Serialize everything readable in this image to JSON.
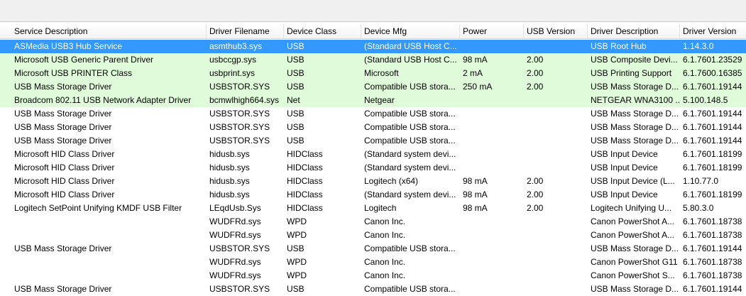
{
  "colors": {
    "selected": "#3399ff",
    "connected": "#e0fbd9"
  },
  "columns": [
    "Service Description",
    "Driver Filename",
    "Device Class",
    "Device Mfg",
    "Power",
    "USB Version",
    "Driver Description",
    "Driver Version"
  ],
  "rows": [
    {
      "state": "selected",
      "cells": [
        "ASMedia USB3 Hub Service",
        "asmthub3.sys",
        "USB",
        "(Standard USB Host C...",
        "",
        "",
        "USB Root Hub",
        "1.14.3.0"
      ]
    },
    {
      "state": "green",
      "cells": [
        "Microsoft USB Generic Parent Driver",
        "usbccgp.sys",
        "USB",
        "(Standard USB Host C...",
        "98 mA",
        "2.00",
        "USB Composite Devi...",
        "6.1.7601.23529"
      ]
    },
    {
      "state": "green",
      "cells": [
        "Microsoft USB PRINTER Class",
        "usbprint.sys",
        "USB",
        "Microsoft",
        "2 mA",
        "2.00",
        "USB Printing Support",
        "6.1.7600.16385"
      ]
    },
    {
      "state": "green",
      "cells": [
        "USB Mass Storage Driver",
        "USBSTOR.SYS",
        "USB",
        "Compatible USB stora...",
        "250 mA",
        "2.00",
        "USB Mass Storage D...",
        "6.1.7601.19144"
      ]
    },
    {
      "state": "green",
      "cells": [
        "Broadcom 802.11 USB Network Adapter Driver",
        "bcmwlhigh664.sys",
        "Net",
        "Netgear",
        "",
        "",
        "NETGEAR WNA3100 ...",
        "5.100.148.5"
      ]
    },
    {
      "state": "",
      "cells": [
        "USB Mass Storage Driver",
        "USBSTOR.SYS",
        "USB",
        "Compatible USB stora...",
        "",
        "",
        "USB Mass Storage D...",
        "6.1.7601.19144"
      ]
    },
    {
      "state": "",
      "cells": [
        "USB Mass Storage Driver",
        "USBSTOR.SYS",
        "USB",
        "Compatible USB stora...",
        "",
        "",
        "USB Mass Storage D...",
        "6.1.7601.19144"
      ]
    },
    {
      "state": "",
      "cells": [
        "USB Mass Storage Driver",
        "USBSTOR.SYS",
        "USB",
        "Compatible USB stora...",
        "",
        "",
        "USB Mass Storage D...",
        "6.1.7601.19144"
      ]
    },
    {
      "state": "",
      "cells": [
        "Microsoft HID Class Driver",
        "hidusb.sys",
        "HIDClass",
        "(Standard system devi...",
        "",
        "",
        "USB Input Device",
        "6.1.7601.18199"
      ]
    },
    {
      "state": "",
      "cells": [
        "Microsoft HID Class Driver",
        "hidusb.sys",
        "HIDClass",
        "(Standard system devi...",
        "",
        "",
        "USB Input Device",
        "6.1.7601.18199"
      ]
    },
    {
      "state": "",
      "cells": [
        "Microsoft HID Class Driver",
        "hidusb.sys",
        "HIDClass",
        "Logitech (x64)",
        "98 mA",
        "2.00",
        "USB Input Device (L...",
        "1.10.77.0"
      ]
    },
    {
      "state": "",
      "cells": [
        "Microsoft HID Class Driver",
        "hidusb.sys",
        "HIDClass",
        "(Standard system devi...",
        "98 mA",
        "2.00",
        "USB Input Device",
        "6.1.7601.18199"
      ]
    },
    {
      "state": "",
      "cells": [
        "Logitech SetPoint Unifying KMDF USB Filter",
        "LEqdUsb.Sys",
        "HIDClass",
        "Logitech",
        "98 mA",
        "2.00",
        "Logitech Unifying U...",
        "5.80.3.0"
      ]
    },
    {
      "state": "",
      "cells": [
        "",
        "WUDFRd.sys",
        "WPD",
        "Canon Inc.",
        "",
        "",
        "Canon PowerShot A...",
        "6.1.7601.18738"
      ]
    },
    {
      "state": "",
      "cells": [
        "",
        "WUDFRd.sys",
        "WPD",
        "Canon Inc.",
        "",
        "",
        "Canon PowerShot A...",
        "6.1.7601.18738"
      ]
    },
    {
      "state": "",
      "cells": [
        "USB Mass Storage Driver",
        "USBSTOR.SYS",
        "USB",
        "Compatible USB stora...",
        "",
        "",
        "USB Mass Storage D...",
        "6.1.7601.19144"
      ]
    },
    {
      "state": "",
      "cells": [
        "",
        "WUDFRd.sys",
        "WPD",
        "Canon Inc.",
        "",
        "",
        "Canon PowerShot G11",
        "6.1.7601.18738"
      ]
    },
    {
      "state": "",
      "cells": [
        "",
        "WUDFRd.sys",
        "WPD",
        "Canon Inc.",
        "",
        "",
        "Canon PowerShot S...",
        "6.1.7601.18738"
      ]
    },
    {
      "state": "",
      "cells": [
        "USB Mass Storage Driver",
        "USBSTOR.SYS",
        "USB",
        "Compatible USB stora...",
        "",
        "",
        "USB Mass Storage D...",
        "6.1.7601.19144"
      ]
    }
  ]
}
